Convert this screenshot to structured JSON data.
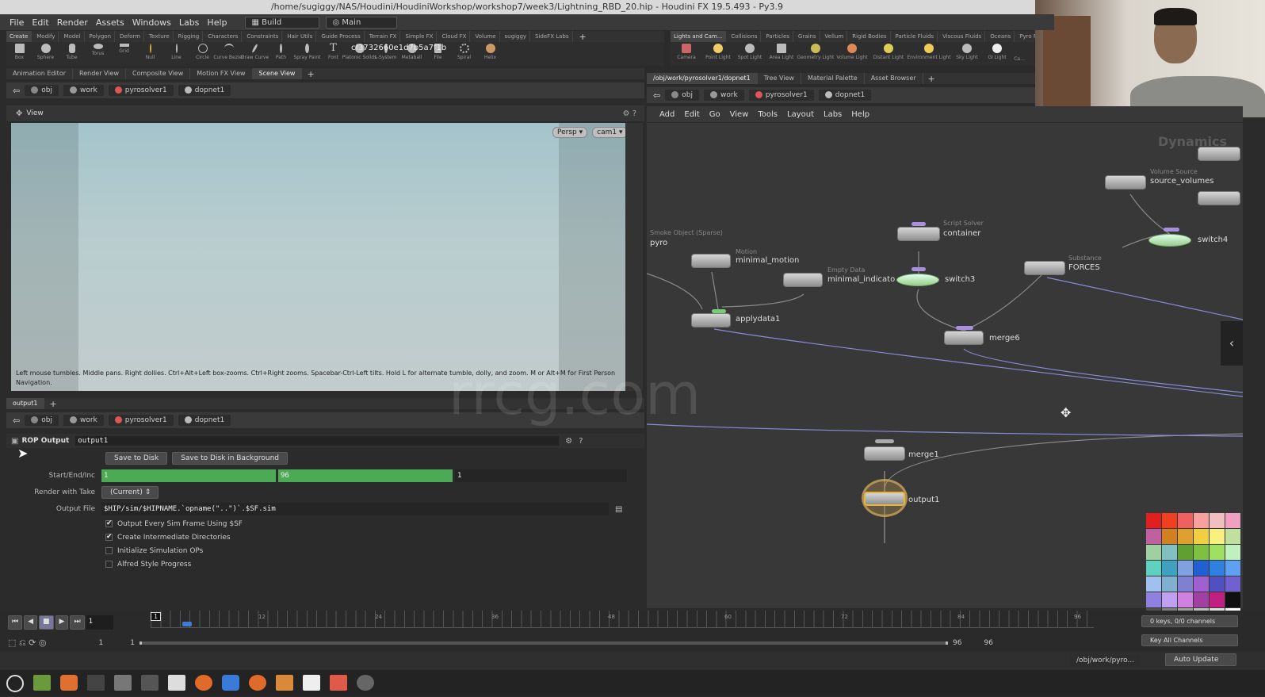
{
  "window_title": "/home/sugiggy/NAS/Houdini/HoudiniWorkshop/workshop7/week3/Lightning_RBD_20.hip - Houdini FX 19.5.493 - Py3.9",
  "menubar": {
    "items": [
      "File",
      "Edit",
      "Render",
      "Assets",
      "Windows",
      "Labs",
      "Help"
    ],
    "desktop": "Build",
    "context": "Main"
  },
  "shelf_left": {
    "tabs": [
      "Create",
      "Modify",
      "Model",
      "Polygon",
      "Deform",
      "Texture",
      "Rigging",
      "Characters",
      "Constraints",
      "Hair Utils",
      "Guide Process",
      "Terrain FX",
      "Simple FX",
      "Cloud FX",
      "Volume",
      "sugiggy",
      "SideFX Labs"
    ],
    "tools": [
      "Box",
      "Sphere",
      "Tube",
      "Torus",
      "Grid",
      "Null",
      "Line",
      "Circle",
      "Curve Bezier",
      "Draw Curve",
      "Path",
      "Spray Paint",
      "Font",
      "Platonic Solids",
      "L-System",
      "Metaball",
      "File",
      "Spiral",
      "Helix"
    ],
    "overlay_text": "cf3732660e1d7b5a7f1b"
  },
  "shelf_right": {
    "tabs": [
      "Lights and Cam...",
      "Collisions",
      "Particles",
      "Grains",
      "Vellum",
      "Rigid Bodies",
      "Particle Fluids",
      "Viscous Fluids",
      "Oceans",
      "Pyro FX"
    ],
    "tools": [
      "Camera",
      "Point Light",
      "Spot Light",
      "Area Light",
      "Geometry Light",
      "Volume Light",
      "Distant Light",
      "Environment Light",
      "Sky Light",
      "GI Light",
      "Ca..."
    ]
  },
  "left_pane_tabs": [
    "Animation Editor",
    "Render View",
    "Composite View",
    "Motion FX View",
    "Scene View"
  ],
  "left_path": [
    "obj",
    "work",
    "pyrosolver1",
    "dopnet1"
  ],
  "viewport": {
    "label": "View",
    "persp": "Persp",
    "cam": "cam1",
    "hint": "Left mouse tumbles. Middle pans. Right dollies. Ctrl+Alt+Left box-zooms. Ctrl+Right zooms. Spacebar-Ctrl-Left tilts. Hold L for alternate tumble, dolly, and zoom.    M or Alt+M for First Person Navigation."
  },
  "param_tab": "output1",
  "param_path": [
    "obj",
    "work",
    "pyrosolver1",
    "dopnet1"
  ],
  "rop": {
    "type": "ROP Output",
    "name": "output1",
    "save_btn": "Save to Disk",
    "save_bg_btn": "Save to Disk in Background",
    "start_label": "Start/End/Inc",
    "start": "1",
    "end": "96",
    "inc": "1",
    "take_label": "Render with Take",
    "take": "(Current)",
    "file_label": "Output File",
    "file": "$HIP/sim/$HIPNAME.`opname(\"..\")`.$SF.sim",
    "checks": [
      {
        "label": "Output Every Sim Frame Using $SF",
        "on": "✔"
      },
      {
        "label": "Create Intermediate Directories",
        "on": "✔"
      },
      {
        "label": "Initialize Simulation OPs",
        "on": ""
      },
      {
        "label": "Alfred Style Progress",
        "on": ""
      }
    ]
  },
  "net_pane_tabs": [
    "/obj/work/pyrosolver1/dopnet1",
    "Tree View",
    "Material Palette",
    "Asset Browser"
  ],
  "net_path": [
    "obj",
    "work",
    "pyrosolver1",
    "dopnet1"
  ],
  "net_menu": [
    "Add",
    "Edit",
    "Go",
    "View",
    "Tools",
    "Layout",
    "Labs",
    "Help"
  ],
  "net_badge": "Dynamics",
  "watermark": "rrcg.com",
  "nodes": {
    "pyro": {
      "type": "Smoke Object (Sparse)",
      "name": "pyro"
    },
    "minimal_motion": {
      "type": "Motion",
      "name": "minimal_motion"
    },
    "minimal_indicator": {
      "type": "Empty Data",
      "name": "minimal_indicato"
    },
    "applydata1": {
      "name": "applydata1"
    },
    "container": {
      "type": "Script Solver",
      "name": "container"
    },
    "switch3": {
      "name": "switch3"
    },
    "merge6": {
      "name": "merge6"
    },
    "forces": {
      "type": "Substance",
      "name": "FORCES"
    },
    "source_volumes": {
      "type": "Volume Source",
      "name": "source_volumes"
    },
    "switch4": {
      "name": "switch4"
    },
    "merge1": {
      "name": "merge1"
    },
    "output1": {
      "name": "output1"
    }
  },
  "palette_colors": [
    "#e02020",
    "#f04020",
    "#f06060",
    "#f8a0a0",
    "#f0c0c0",
    "#f0a0c0",
    "#c060a0",
    "#d08020",
    "#e0a030",
    "#f0d040",
    "#f8f080",
    "#c0e0a0",
    "#a0d0a0",
    "#80c0c0",
    "#60a030",
    "#80c040",
    "#a0e060",
    "#c0f0c0",
    "#60d0c0",
    "#40a0c0",
    "#80a0e0",
    "#2060d0",
    "#3080e0",
    "#60a0f0",
    "#a0c0f0",
    "#80b0d0",
    "#8080d0",
    "#a060d0",
    "#5050c0",
    "#7060d0",
    "#9080e0",
    "#c0a0f0",
    "#d080e0",
    "#a040a0",
    "#c02080",
    "#101010",
    "#505050",
    "#808080",
    "#a0a0a0",
    "#c0c0c0",
    "#e0e0e0",
    "#ffffff"
  ],
  "timeline": {
    "current": "1",
    "start": "1",
    "end": "96",
    "range_start": "1",
    "range_sub": "1",
    "range_end": "96",
    "range_end2": "96",
    "ticks": [
      "12",
      "24",
      "36",
      "48",
      "60",
      "72",
      "84",
      "96"
    ],
    "keys_btn": "0 keys, 0/0 channels",
    "key_all": "Key All Channels"
  },
  "status": {
    "path": "/obj/work/pyro...",
    "update": "Auto Update"
  }
}
